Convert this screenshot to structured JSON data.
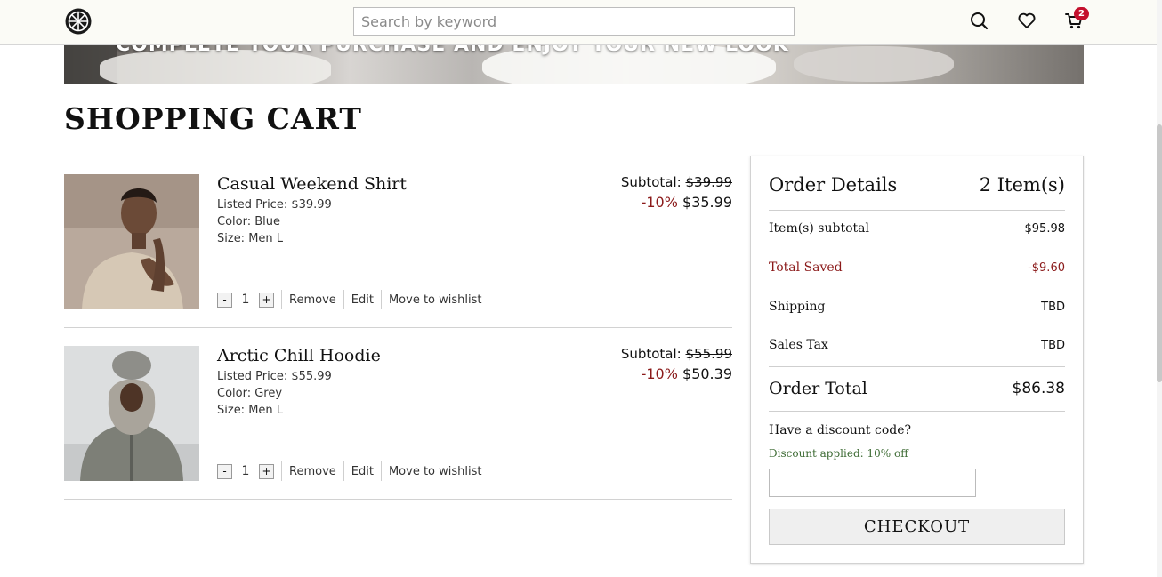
{
  "header": {
    "search_placeholder": "Search by keyword",
    "cart_count": "2",
    "icons": [
      "logo-icon",
      "search-icon",
      "heart-icon",
      "cart-icon"
    ]
  },
  "banner": {
    "text": "COMPLETE YOUR PURCHASE AND ENJOY YOUR NEW LOOK"
  },
  "page": {
    "title": "SHOPPING CART"
  },
  "cart": {
    "items": [
      {
        "name": "Casual Weekend Shirt",
        "listed_price": "Listed Price: $39.99",
        "color": "Color: Blue",
        "size": "Size: Men L",
        "subtotal_label": "Subtotal:",
        "original_price": "$39.99",
        "discount_pct": "-10%",
        "discounted_price": "$35.99",
        "qty": "1",
        "minus": "-",
        "plus": "+",
        "remove": "Remove",
        "edit": "Edit",
        "wishlist": "Move to wishlist"
      },
      {
        "name": "Arctic Chill Hoodie",
        "listed_price": "Listed Price: $55.99",
        "color": "Color: Grey",
        "size": "Size: Men L",
        "subtotal_label": "Subtotal:",
        "original_price": "$55.99",
        "discount_pct": "-10%",
        "discounted_price": "$50.39",
        "qty": "1",
        "minus": "-",
        "plus": "+",
        "remove": "Remove",
        "edit": "Edit",
        "wishlist": "Move to wishlist"
      }
    ]
  },
  "order": {
    "title": "Order Details",
    "count": "2 Item(s)",
    "rows": [
      {
        "label": "Item(s) subtotal",
        "value": "$95.98"
      },
      {
        "label": "Total Saved",
        "value": "-$9.60"
      },
      {
        "label": "Shipping",
        "value": "TBD"
      },
      {
        "label": "Sales Tax",
        "value": "TBD"
      }
    ],
    "total_label": "Order Total",
    "total_value": "$86.38",
    "discount_question": "Have a discount code?",
    "discount_applied": "Discount applied: 10% off",
    "discount_input_value": "",
    "checkout_label": "CHECKOUT"
  },
  "colors": {
    "accent_red": "#8b1a1a",
    "badge_red": "#c4102d",
    "success_green": "#3d6b34",
    "header_bg": "#fbfbf6"
  }
}
